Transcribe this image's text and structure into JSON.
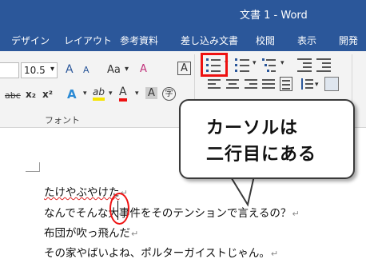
{
  "window": {
    "title": "文書 1  -  Word"
  },
  "tabs": [
    "デザイン",
    "レイアウト",
    "参考資料",
    "差し込み文書",
    "校閲",
    "表示",
    "開発"
  ],
  "ribbon": {
    "font_size": "10.5",
    "font_size_arrow": "▾",
    "font_case_label": "Aa",
    "grow_font": "A",
    "shrink_font": "A",
    "clear_format_label": "A",
    "char_border_label": "A",
    "strike_label": "abc",
    "subscript_label": "x₂",
    "superscript_label": "x²",
    "text_effect_label": "A",
    "highlight_label": "ab",
    "font_color_label": "A",
    "aa_label": "A",
    "enclosed_char_label": "字",
    "group_label": "フォント"
  },
  "callout": {
    "line1": "カーソルは",
    "line2": "二行目にある"
  },
  "document": {
    "line1": "たけやぶやけた",
    "line2_before": "なんでそんな大",
    "line2_after": "事件をそのテンションで言えるの？",
    "line3": "布団が吹っ飛んだ",
    "line4": "その家やばいよね、ポルターガイストじゃん。",
    "paragraph_mark": "↵"
  }
}
